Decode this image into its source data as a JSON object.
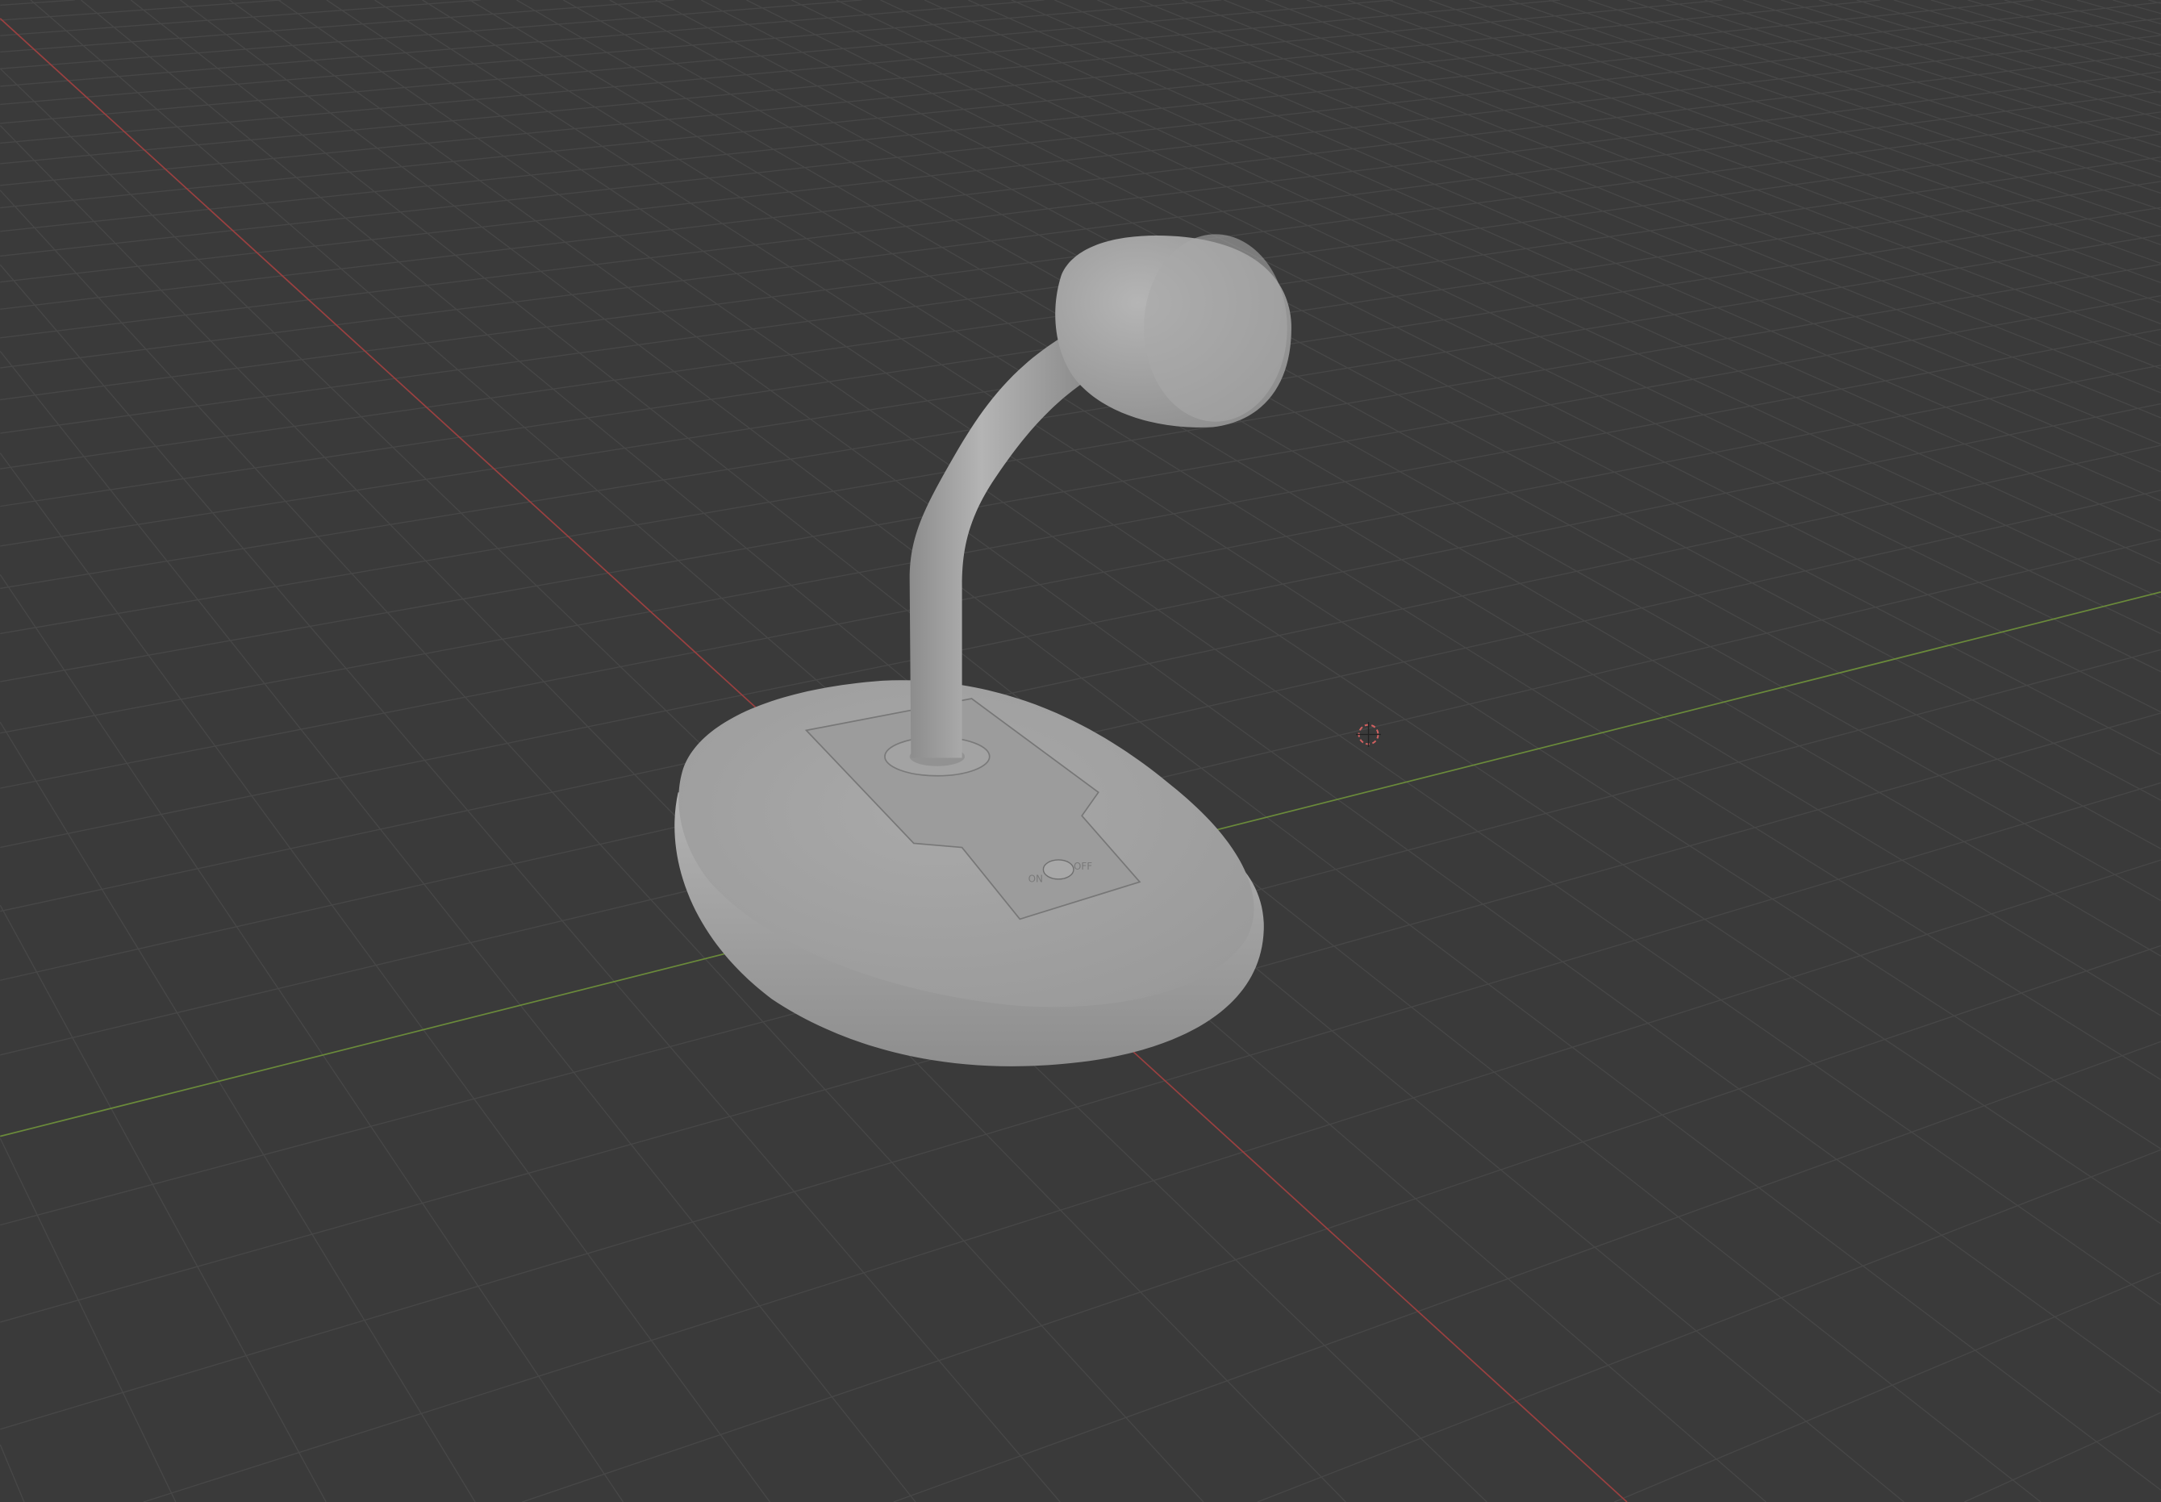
{
  "viewport": {
    "background": "#3a3a3a",
    "grid_color": "#474747",
    "x_axis_color": "#9a4040",
    "y_axis_color": "#6a8a3a",
    "cursor_icon": "3d-cursor-icon"
  },
  "model": {
    "name": "desk-microphone",
    "color": "#a6a6a6",
    "switch_on_label": "ON",
    "switch_off_label": "OFF"
  }
}
